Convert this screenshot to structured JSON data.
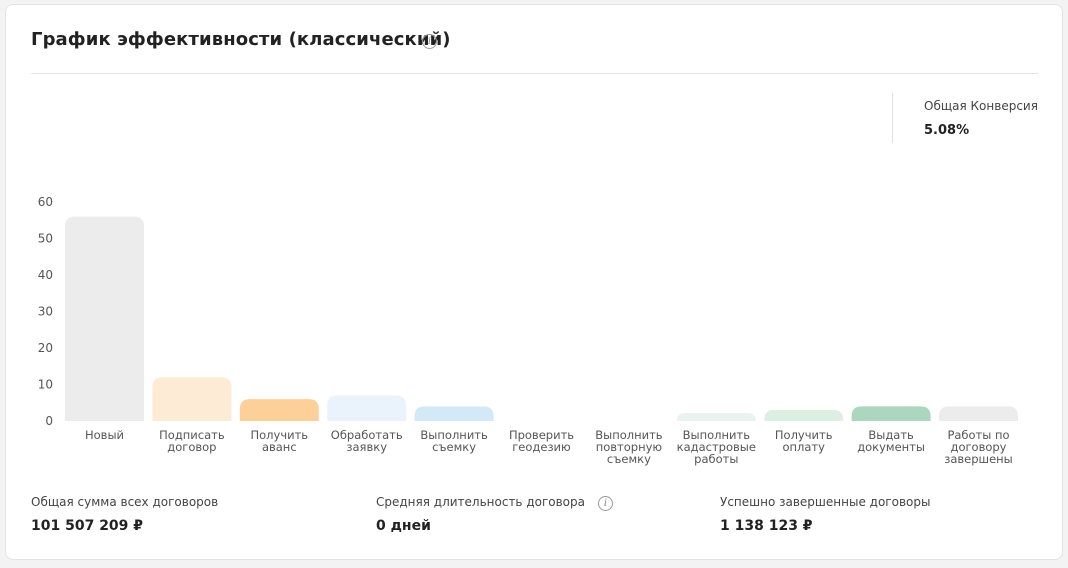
{
  "header": {
    "title": "График эффективности (классический)"
  },
  "conversion": {
    "label": "Общая Конверсия",
    "value": "5.08%"
  },
  "chart_data": {
    "type": "bar",
    "categories": [
      [
        "Новый"
      ],
      [
        "Подписать",
        "договор"
      ],
      [
        "Получить",
        "аванс"
      ],
      [
        "Обработать",
        "заявку"
      ],
      [
        "Выполнить",
        "съемку"
      ],
      [
        "Проверить",
        "геодезию"
      ],
      [
        "Выполнить",
        "повторную",
        "съемку"
      ],
      [
        "Выполнить",
        "кадастровые",
        "работы"
      ],
      [
        "Получить",
        "оплату"
      ],
      [
        "Выдать",
        "документы"
      ],
      [
        "Работы по",
        "договору",
        "завершены"
      ]
    ],
    "values": [
      56,
      12,
      6,
      7,
      4,
      0,
      0,
      2,
      3,
      4,
      4
    ],
    "colors": [
      "#ececec",
      "#fdebd6",
      "#fdd09a",
      "#eaf3fb",
      "#d3e9f7",
      "#eeeeee",
      "#eeeeee",
      "#e9f3ef",
      "#dcefe3",
      "#acd6bd",
      "#ececec"
    ],
    "ylim": [
      0,
      60
    ],
    "yticks": [
      "0",
      "10",
      "20",
      "30",
      "40",
      "50",
      "60"
    ],
    "grid": false,
    "title": "",
    "xlabel": "",
    "ylabel": ""
  },
  "stats": [
    {
      "label": "Общая сумма всех договоров",
      "value": "101 507 209 ₽"
    },
    {
      "label": "Средняя длительность договора",
      "value": "0 дней"
    },
    {
      "label": "Успешно завершенные договоры",
      "value": "1 138 123 ₽"
    }
  ],
  "icons": {
    "title_info": "info-icon",
    "duration_info": "info-icon"
  }
}
